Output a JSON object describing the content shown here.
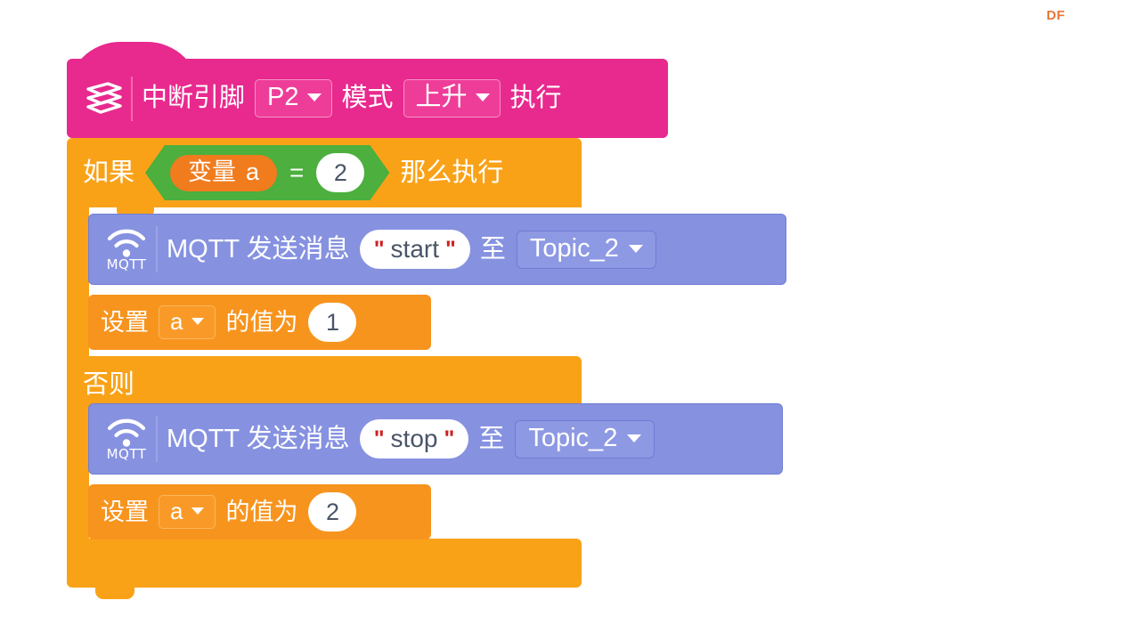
{
  "watermark": {
    "text": "DF"
  },
  "colors": {
    "event_pink": "#E8298E",
    "control_orange": "#F9A218",
    "variable_orange": "#F07C1E",
    "operator_green": "#4CAF3E",
    "mqtt_purple": "#8692E0",
    "input_white": "#FFFFFF",
    "quote_red": "#CC2020",
    "watermark_orange": "#E8773C"
  },
  "program": {
    "hat_block": {
      "icon": "stacked-layers-icon",
      "label_1": "中断引脚",
      "pin_dropdown": {
        "value": "P2"
      },
      "label_2": "模式",
      "mode_dropdown": {
        "value": "上升"
      },
      "label_3": "执行"
    },
    "if_block": {
      "if_label": "如果",
      "condition": {
        "left_operand": {
          "prefix": "变量",
          "name": "a"
        },
        "operator": "=",
        "right_operand": "2"
      },
      "then_label": "那么执行",
      "else_label": "否则",
      "then_branch": [
        {
          "type": "mqtt-send",
          "icon": "wifi-icon",
          "icon_word": "MQTT",
          "label_1": "MQTT 发送消息",
          "message": "start",
          "quote_open": "\"",
          "quote_close": "\"",
          "label_2": "至",
          "topic_dropdown": {
            "value": "Topic_2"
          }
        },
        {
          "type": "set-variable",
          "label_1": "设置",
          "variable_dropdown": {
            "value": "a"
          },
          "label_2": "的值为",
          "value": "1"
        }
      ],
      "else_branch": [
        {
          "type": "mqtt-send",
          "icon": "wifi-icon",
          "icon_word": "MQTT",
          "label_1": "MQTT 发送消息",
          "message": "stop",
          "quote_open": "\"",
          "quote_close": "\"",
          "label_2": "至",
          "topic_dropdown": {
            "value": "Topic_2"
          }
        },
        {
          "type": "set-variable",
          "label_1": "设置",
          "variable_dropdown": {
            "value": "a"
          },
          "label_2": "的值为",
          "value": "2"
        }
      ]
    }
  }
}
